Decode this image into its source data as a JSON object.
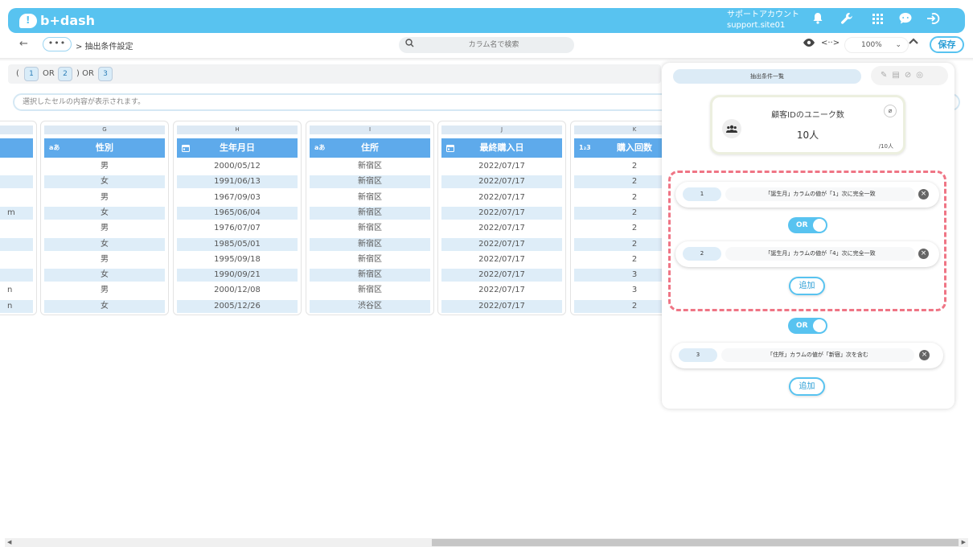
{
  "header": {
    "logo_text": "b+dash",
    "account_name": "サポートアカウント",
    "site": "support.site01"
  },
  "toolbar": {
    "dots": "•••",
    "breadcrumb": "> 抽出条件設定",
    "search_placeholder": "カラム名で検索",
    "zoom": "100%",
    "save_label": "保存"
  },
  "condition_formula": {
    "open": "(",
    "c1": "1",
    "or1": "OR",
    "c2": "2",
    "close_or": ") OR",
    "c3": "3"
  },
  "cell_bar_text": "選択したセルの内容が表示されます。",
  "grid": {
    "first_col_values": [
      "",
      "",
      "",
      "m",
      "",
      "",
      "",
      "",
      "n",
      "n"
    ],
    "columns": [
      {
        "letter": "G",
        "header": "性別",
        "type_icon": "a-あ",
        "values": [
          "男",
          "女",
          "男",
          "女",
          "男",
          "女",
          "男",
          "女",
          "男",
          "女"
        ]
      },
      {
        "letter": "H",
        "header": "生年月日",
        "type_icon": "calendar",
        "values": [
          "2000/05/12",
          "1991/06/13",
          "1967/09/03",
          "1965/06/04",
          "1976/07/07",
          "1985/05/01",
          "1995/09/18",
          "1990/09/21",
          "2000/12/08",
          "2005/12/26"
        ]
      },
      {
        "letter": "I",
        "header": "住所",
        "type_icon": "a-あ",
        "values": [
          "新宿区",
          "新宿区",
          "新宿区",
          "新宿区",
          "新宿区",
          "新宿区",
          "新宿区",
          "新宿区",
          "新宿区",
          "渋谷区"
        ]
      },
      {
        "letter": "J",
        "header": "最終購入日",
        "type_icon": "calendar",
        "values": [
          "2022/07/17",
          "2022/07/17",
          "2022/07/17",
          "2022/07/17",
          "2022/07/17",
          "2022/07/17",
          "2022/07/17",
          "2022/07/17",
          "2022/07/17",
          "2022/07/17"
        ]
      },
      {
        "letter": "K",
        "header": "購入回数",
        "type_icon": "1-2-3",
        "values": [
          "2",
          "2",
          "2",
          "2",
          "2",
          "2",
          "2",
          "3",
          "3",
          "2"
        ]
      }
    ]
  },
  "panel": {
    "title": "抽出条件一覧",
    "kpi": {
      "title": "顧客IDのユニーク数",
      "value": "10人",
      "sub": "/10人"
    },
    "conditions": [
      {
        "num": "1",
        "text": "「誕生月」カラムの値が「1」次に完全一致"
      },
      {
        "num": "2",
        "text": "「誕生月」カラムの値が「4」次に完全一致"
      },
      {
        "num": "3",
        "text": "「住所」カラムの値が「新宿」次を含む"
      }
    ],
    "toggle1": "OR",
    "toggle2": "OR",
    "add1": "追加",
    "add2": "追加"
  },
  "colors": {
    "accent": "#58c3f0",
    "header_blue": "#5eaaeb",
    "dashed_highlight": "#ef7585"
  }
}
